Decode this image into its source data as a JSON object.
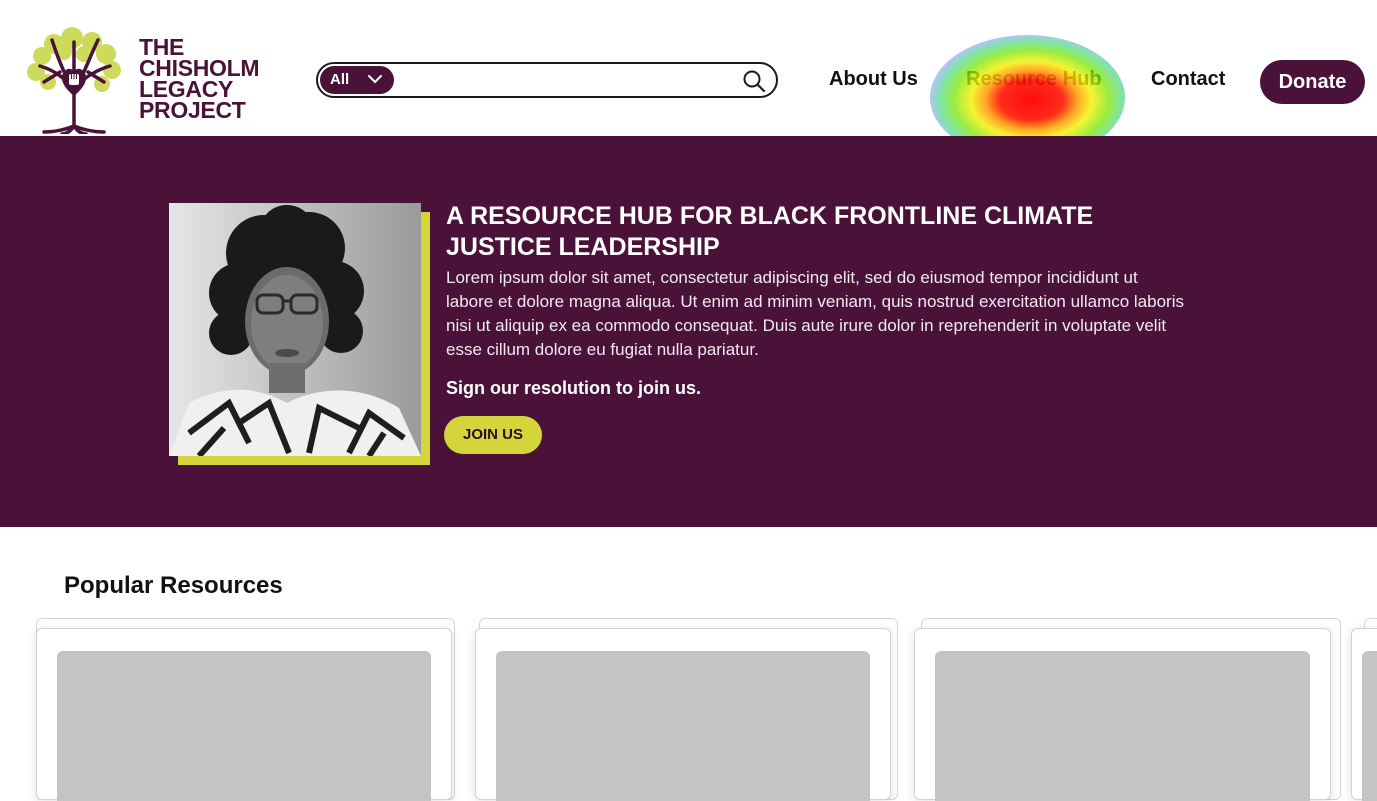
{
  "header": {
    "logo_lines": [
      "THE",
      "CHISHOLM",
      "LEGACY",
      "PROJECT"
    ],
    "search": {
      "scope_label": "All",
      "placeholder": "",
      "value": ""
    },
    "nav": {
      "about": "About Us",
      "hub": "Resource Hub",
      "contact": "Contact",
      "donate": "Donate"
    }
  },
  "hero": {
    "title": "A RESOURCE HUB FOR BLACK FRONTLINE CLIMATE JUSTICE LEADERSHIP",
    "body": "Lorem ipsum dolor sit amet, consectetur adipiscing elit, sed do eiusmod tempor incididunt ut labore et dolore magna aliqua. Ut enim ad minim veniam, quis nostrud exercitation ullamco laboris nisi ut aliquip ex ea commodo consequat. Duis aute irure dolor in reprehenderit in voluptate velit esse cillum dolore eu fugiat nulla pariatur.",
    "cta_text": "Sign our resolution to join us.",
    "cta_button": "JOIN US"
  },
  "resources": {
    "title": "Popular Resources"
  },
  "colors": {
    "brand_plum": "#4a1238",
    "accent_lime": "#d4d53a",
    "placeholder_gray": "#c4c4c4"
  },
  "icons": {
    "search": "search-icon",
    "chevron": "chevron-down-icon",
    "logo": "tree-heart-fist-logo-icon"
  }
}
